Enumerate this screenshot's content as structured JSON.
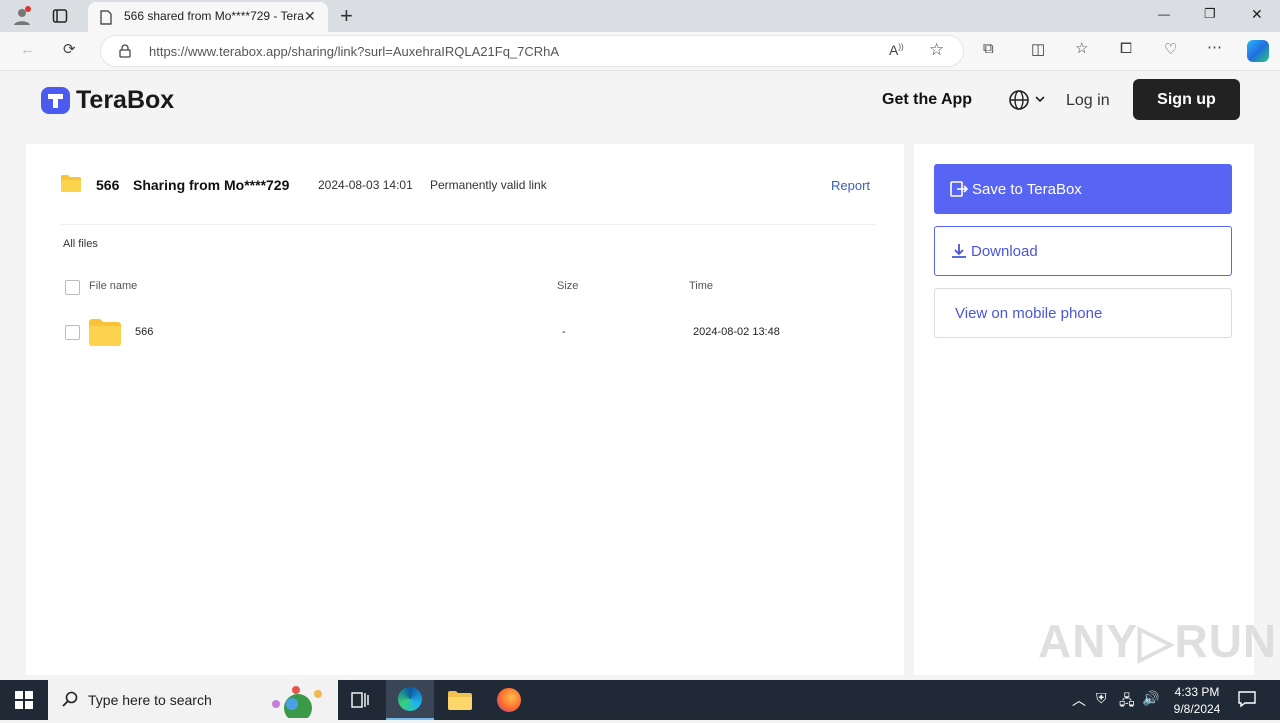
{
  "browser": {
    "tab_title": "566 shared from Mo****729 - TeraBox",
    "tab_close": "✕",
    "new_tab": "+",
    "url": "https://www.terabox.app/sharing/link?surl=AuxehraIRQLA21Fq_7CRhA",
    "window_controls": {
      "minimize": "—",
      "restore": "❐",
      "close": "✕"
    }
  },
  "header": {
    "brand": "TeraBox",
    "get_app": "Get the App",
    "login": "Log in",
    "signup": "Sign up"
  },
  "share": {
    "count": "566",
    "title": "Sharing from Mo****729",
    "date": "2024-08-03 14:01",
    "validity": "Permanently valid link",
    "report": "Report",
    "breadcrumb": "All files"
  },
  "table": {
    "columns": {
      "name": "File name",
      "size": "Size",
      "time": "Time"
    },
    "rows": [
      {
        "name": "566",
        "size": "-",
        "time": "2024-08-02 13:48"
      }
    ]
  },
  "actions": {
    "save": "Save to TeraBox",
    "download": "Download",
    "mobile": "View on mobile phone"
  },
  "taskbar": {
    "search_placeholder": "Type here to search",
    "time": "4:33 PM",
    "date": "9/8/2024"
  },
  "watermark": "ANY▷RUN",
  "colors": {
    "accent": "#5865f2",
    "link": "#3b5fb6",
    "folder": "#f8c33a",
    "taskbar": "#202a36"
  }
}
